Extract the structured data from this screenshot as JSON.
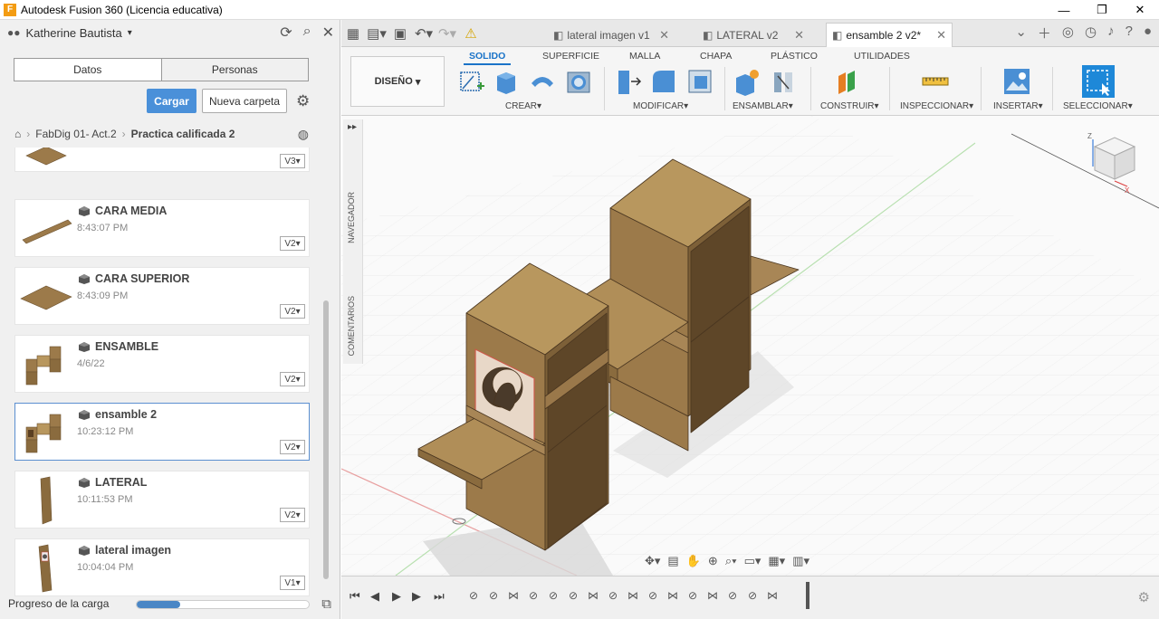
{
  "window": {
    "title": "Autodesk Fusion 360 (Licencia educativa)",
    "minimize": "—",
    "restore": "❐",
    "close": "✕"
  },
  "data_panel": {
    "user": "Katherine Bautista",
    "segments": [
      "Datos",
      "Personas"
    ],
    "upload_label": "Cargar",
    "new_folder_label": "Nueva carpeta",
    "breadcrumb": [
      "FabDig 01- Act.2",
      "Practica calificada 2"
    ],
    "items": [
      {
        "name": "",
        "time": "",
        "version": "V3"
      },
      {
        "name": "CARA MEDIA",
        "time": "8:43:07 PM",
        "version": "V2"
      },
      {
        "name": "CARA SUPERIOR",
        "time": "8:43:09 PM",
        "version": "V2"
      },
      {
        "name": "ENSAMBLE",
        "time": "4/6/22",
        "version": "V2"
      },
      {
        "name": "ensamble 2",
        "time": "10:23:12 PM",
        "version": "V2"
      },
      {
        "name": "LATERAL",
        "time": "10:11:53 PM",
        "version": "V2"
      },
      {
        "name": "lateral imagen",
        "time": "10:04:04 PM",
        "version": "V1"
      }
    ],
    "progress_label": "Progreso de la carga",
    "progress_fraction": 0.25
  },
  "tabs": [
    {
      "label": "lateral imagen v1"
    },
    {
      "label": "LATERAL v2"
    },
    {
      "label": "ensamble 2 v2*"
    }
  ],
  "ribbon": {
    "workspace": "DISEÑO",
    "tabs": [
      "SOLIDO",
      "SUPERFICIE",
      "MALLA",
      "CHAPA",
      "PLÁSTICO",
      "UTILIDADES"
    ],
    "groups": [
      "CREAR",
      "MODIFICAR",
      "ENSAMBLAR",
      "CONSTRUIR",
      "INSPECCIONAR",
      "INSERTAR",
      "SELECCIONAR"
    ]
  },
  "viewport": {
    "side_labels": [
      "NAVEGADOR",
      "COMENTARIOS"
    ],
    "viewcube_axes": {
      "z": "Z",
      "x": "X"
    }
  },
  "colors": {
    "accent": "#1a73c8",
    "wood": "#9c7a4a",
    "wood_dark": "#6e5432",
    "wood_light": "#b8975e",
    "primary_button": "#4a90d9"
  }
}
